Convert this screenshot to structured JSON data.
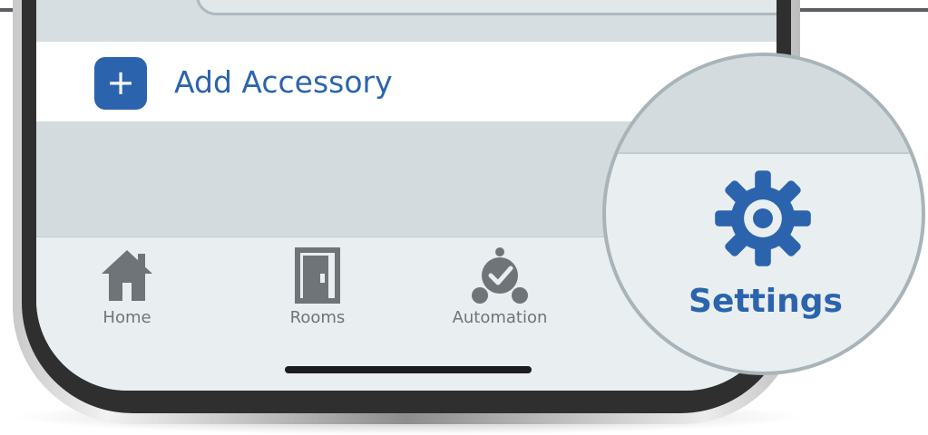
{
  "add_accessory": {
    "icon": "plus-icon",
    "label": "Add Accessory"
  },
  "tab_bar": {
    "items": [
      {
        "label": "Home",
        "icon": "home-icon"
      },
      {
        "label": "Rooms",
        "icon": "door-icon"
      },
      {
        "label": "Automation",
        "icon": "alarm-clock-check-icon"
      }
    ]
  },
  "magnifier": {
    "label": "Settings",
    "icon": "gear-icon"
  },
  "colors": {
    "accent": "#2b64ad",
    "tab_icon": "#6e7478",
    "screen_bg": "#d3dbde",
    "tab_bar_bg": "#e9eef0"
  }
}
